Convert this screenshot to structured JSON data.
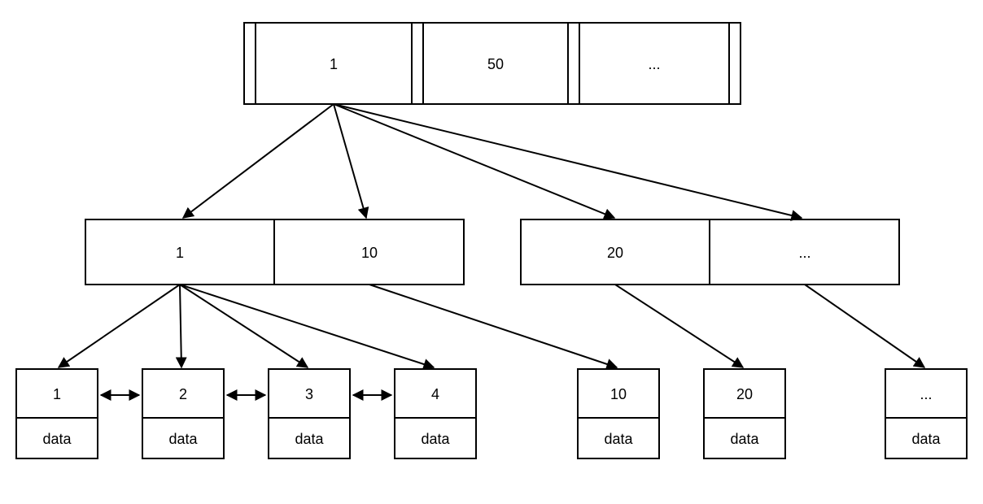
{
  "root": {
    "cells": [
      "1",
      "50",
      "..."
    ]
  },
  "mid_left": {
    "cells": [
      "1",
      "10"
    ]
  },
  "mid_right": {
    "cells": [
      "20",
      "..."
    ]
  },
  "leaves": [
    {
      "key": "1",
      "data": "data"
    },
    {
      "key": "2",
      "data": "data"
    },
    {
      "key": "3",
      "data": "data"
    },
    {
      "key": "4",
      "data": "data"
    },
    {
      "key": "10",
      "data": "data"
    },
    {
      "key": "20",
      "data": "data"
    },
    {
      "key": "...",
      "data": "data"
    }
  ]
}
